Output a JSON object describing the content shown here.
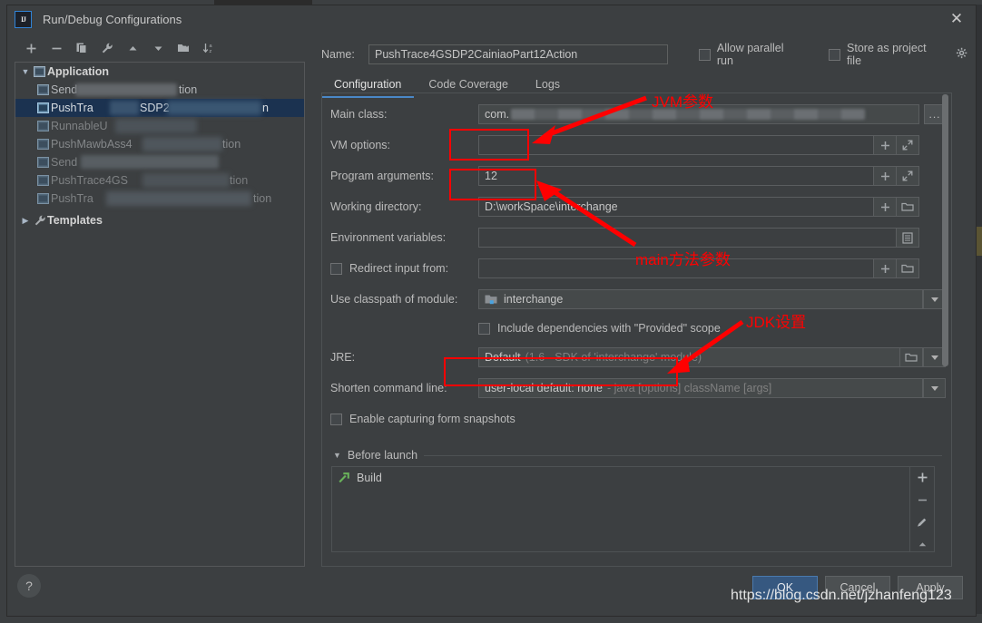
{
  "window": {
    "title": "Run/Debug Configurations",
    "logo_text": "IJ",
    "close_label": "✕"
  },
  "left_pane": {
    "toolbar": [
      {
        "name": "add-configuration-button",
        "icon": "plus-icon"
      },
      {
        "name": "remove-configuration-button",
        "icon": "minus-icon"
      },
      {
        "name": "copy-configuration-button",
        "icon": "copy-icon"
      },
      {
        "name": "edit-templates-button",
        "icon": "wrench-icon"
      },
      {
        "name": "move-up-button",
        "icon": "arrow-up-icon"
      },
      {
        "name": "move-down-button",
        "icon": "arrow-down-icon"
      },
      {
        "name": "new-folder-button",
        "icon": "folder-add-icon"
      },
      {
        "name": "sort-configurations-button",
        "icon": "sort-az-icon"
      }
    ],
    "tree": [
      {
        "label": "Application",
        "type": "group",
        "expanded": true,
        "selected": false,
        "redacted": false
      },
      {
        "label": "Send",
        "type": "item",
        "selected": false,
        "redacted": true,
        "suffix": "tion"
      },
      {
        "label": "PushTra",
        "type": "item",
        "selected": true,
        "redacted": true,
        "suffix": "n",
        "mid": "SDP2"
      },
      {
        "label": "RunnableU",
        "type": "item",
        "selected": false,
        "redacted": true,
        "suffix": ""
      },
      {
        "label": "PushMawbAss4",
        "type": "item",
        "selected": false,
        "redacted": true,
        "suffix": "tion"
      },
      {
        "label": "Send",
        "type": "item",
        "selected": false,
        "redacted": true,
        "suffix": ""
      },
      {
        "label": "PushTrace4GS",
        "type": "item",
        "selected": false,
        "redacted": true,
        "suffix": "tion"
      },
      {
        "label": "PushTra",
        "type": "item",
        "selected": false,
        "redacted": true,
        "suffix": "tion"
      },
      {
        "label": "Templates",
        "type": "group",
        "expanded": false,
        "selected": false,
        "redacted": false
      }
    ]
  },
  "right_pane": {
    "name_label": "Name:",
    "name_value": "PushTrace4GSDP2CainiaoPart12Action",
    "allow_parallel_run": {
      "label": "Allow parallel run",
      "checked": false
    },
    "store_as_project_file": {
      "label": "Store as project file",
      "checked": false
    },
    "tabs": [
      {
        "label": "Configuration",
        "active": true
      },
      {
        "label": "Code Coverage",
        "active": false
      },
      {
        "label": "Logs",
        "active": false
      }
    ],
    "fields": {
      "main_class": {
        "label": "Main class:",
        "value": "com.",
        "redacted": true,
        "button": "..."
      },
      "vm_options": {
        "label": "VM options:",
        "value": "",
        "buttons": [
          "plus-icon",
          "expand-icon"
        ]
      },
      "program_arguments": {
        "label": "Program arguments:",
        "value": "12",
        "buttons": [
          "plus-icon",
          "expand-icon"
        ]
      },
      "working_directory": {
        "label": "Working directory:",
        "value": "D:\\workSpace\\interchange",
        "buttons": [
          "plus-icon",
          "folder-icon"
        ]
      },
      "environment_variables": {
        "label": "Environment variables:",
        "value": "",
        "buttons": [
          "list-icon"
        ]
      },
      "redirect_input_from": {
        "label": "Redirect input from:",
        "checked": false,
        "value": "",
        "buttons": [
          "plus-icon",
          "folder-icon"
        ]
      },
      "use_classpath_of_module": {
        "label": "Use classpath of module:",
        "value": "interchange",
        "icon": "module-icon"
      },
      "include_provided_dependencies": {
        "label": "Include dependencies with \"Provided\" scope",
        "checked": false
      },
      "jre": {
        "label": "JRE:",
        "value": "Default",
        "hint": "(1.6 - SDK of 'interchange' module)",
        "buttons": [
          "folder-icon",
          "chevron-down-icon"
        ]
      },
      "shorten_command_line": {
        "label": "Shorten command line:",
        "value": "user-local default: none",
        "hint": "- java [options] className [args]",
        "buttons": [
          "chevron-down-icon"
        ]
      },
      "enable_capturing_form_snapshots": {
        "label": "Enable capturing form snapshots",
        "checked": false
      }
    },
    "before_launch": {
      "title": "Before launch",
      "expanded": true,
      "items": [
        {
          "label": "Build",
          "icon": "build-hammer-icon"
        }
      ],
      "side_buttons": [
        {
          "name": "before-launch-add-button",
          "icon": "plus-icon"
        },
        {
          "name": "before-launch-remove-button",
          "icon": "minus-icon"
        },
        {
          "name": "before-launch-edit-button",
          "icon": "pencil-icon"
        },
        {
          "name": "before-launch-move-up-button",
          "icon": "arrow-up-icon"
        }
      ]
    }
  },
  "footer": {
    "help_label": "?",
    "ok_label": "OK",
    "cancel_label": "Cancel",
    "apply_label": "Apply"
  },
  "annotations": {
    "color": "#ff0000",
    "items": [
      {
        "name": "annotation-jvm-args",
        "text": "JVM参数"
      },
      {
        "name": "annotation-main-args",
        "text": "main方法参数"
      },
      {
        "name": "annotation-jdk-settings",
        "text": "JDK设置"
      }
    ]
  },
  "watermark": {
    "text": "https://blog.csdn.net/jzhanfeng123"
  }
}
